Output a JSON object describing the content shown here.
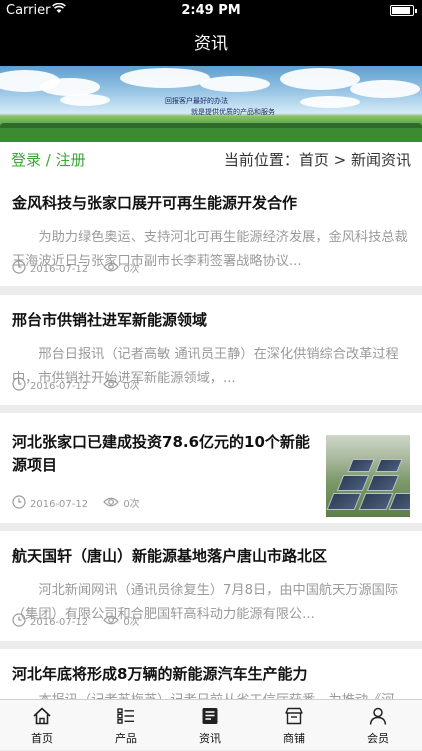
{
  "status_bar": {
    "carrier": "Carrier",
    "time": "2:49 PM"
  },
  "nav": {
    "title": "资讯"
  },
  "banner": {
    "slogan_line1": "回报客户最好的办法",
    "slogan_line2": "就是提供优质的产品和服务"
  },
  "location_bar": {
    "login": "登录",
    "separator": " / ",
    "register": "注册",
    "breadcrumb": "当前位置：首页 > 新闻资讯"
  },
  "news": [
    {
      "title": "金风科技与张家口展开可再生能源开发合作",
      "summary": "为助力绿色奥运、支持河北可再生能源经济发展，金风科技总裁王海波近日与张家口市副市长李莉签署战略协议...",
      "date": "2016-07-12",
      "views": "0次"
    },
    {
      "title": "邢台市供销社进军新能源领域",
      "summary": "邢台日报讯（记者高敏 通讯员王静）在深化供销综合改革过程中，市供销社开始进军新能源领域，...",
      "date": "2016-07-12",
      "views": "0次"
    },
    {
      "title": "河北张家口已建成投资78.6亿元的10个新能源项目",
      "summary": "",
      "date": "2016-07-12",
      "views": "0次"
    },
    {
      "title": "航天国轩（唐山）新能源基地落户唐山市路北区",
      "summary": "河北新闻网讯（通讯员徐复生）7月8日，由中国航天万源国际（集团）有限公司和合肥国轩高科动力能源有限公...",
      "date": "2016-07-12",
      "views": "0次"
    },
    {
      "title": "河北年底将形成8万辆的新能源汽车生产能力",
      "summary": "本报讯（记者苏梅芝）记者日前从省工信厅获悉，为推动《河",
      "date": "",
      "views": ""
    }
  ],
  "tabbar": {
    "items": [
      {
        "label": "首页",
        "icon": "home-icon"
      },
      {
        "label": "产品",
        "icon": "list-icon"
      },
      {
        "label": "资讯",
        "icon": "news-icon"
      },
      {
        "label": "商铺",
        "icon": "store-icon"
      },
      {
        "label": "会员",
        "icon": "user-icon"
      }
    ]
  },
  "colors": {
    "accent": "#3aa635",
    "nav_bg": "#000000",
    "muted": "#9a9a9a"
  }
}
